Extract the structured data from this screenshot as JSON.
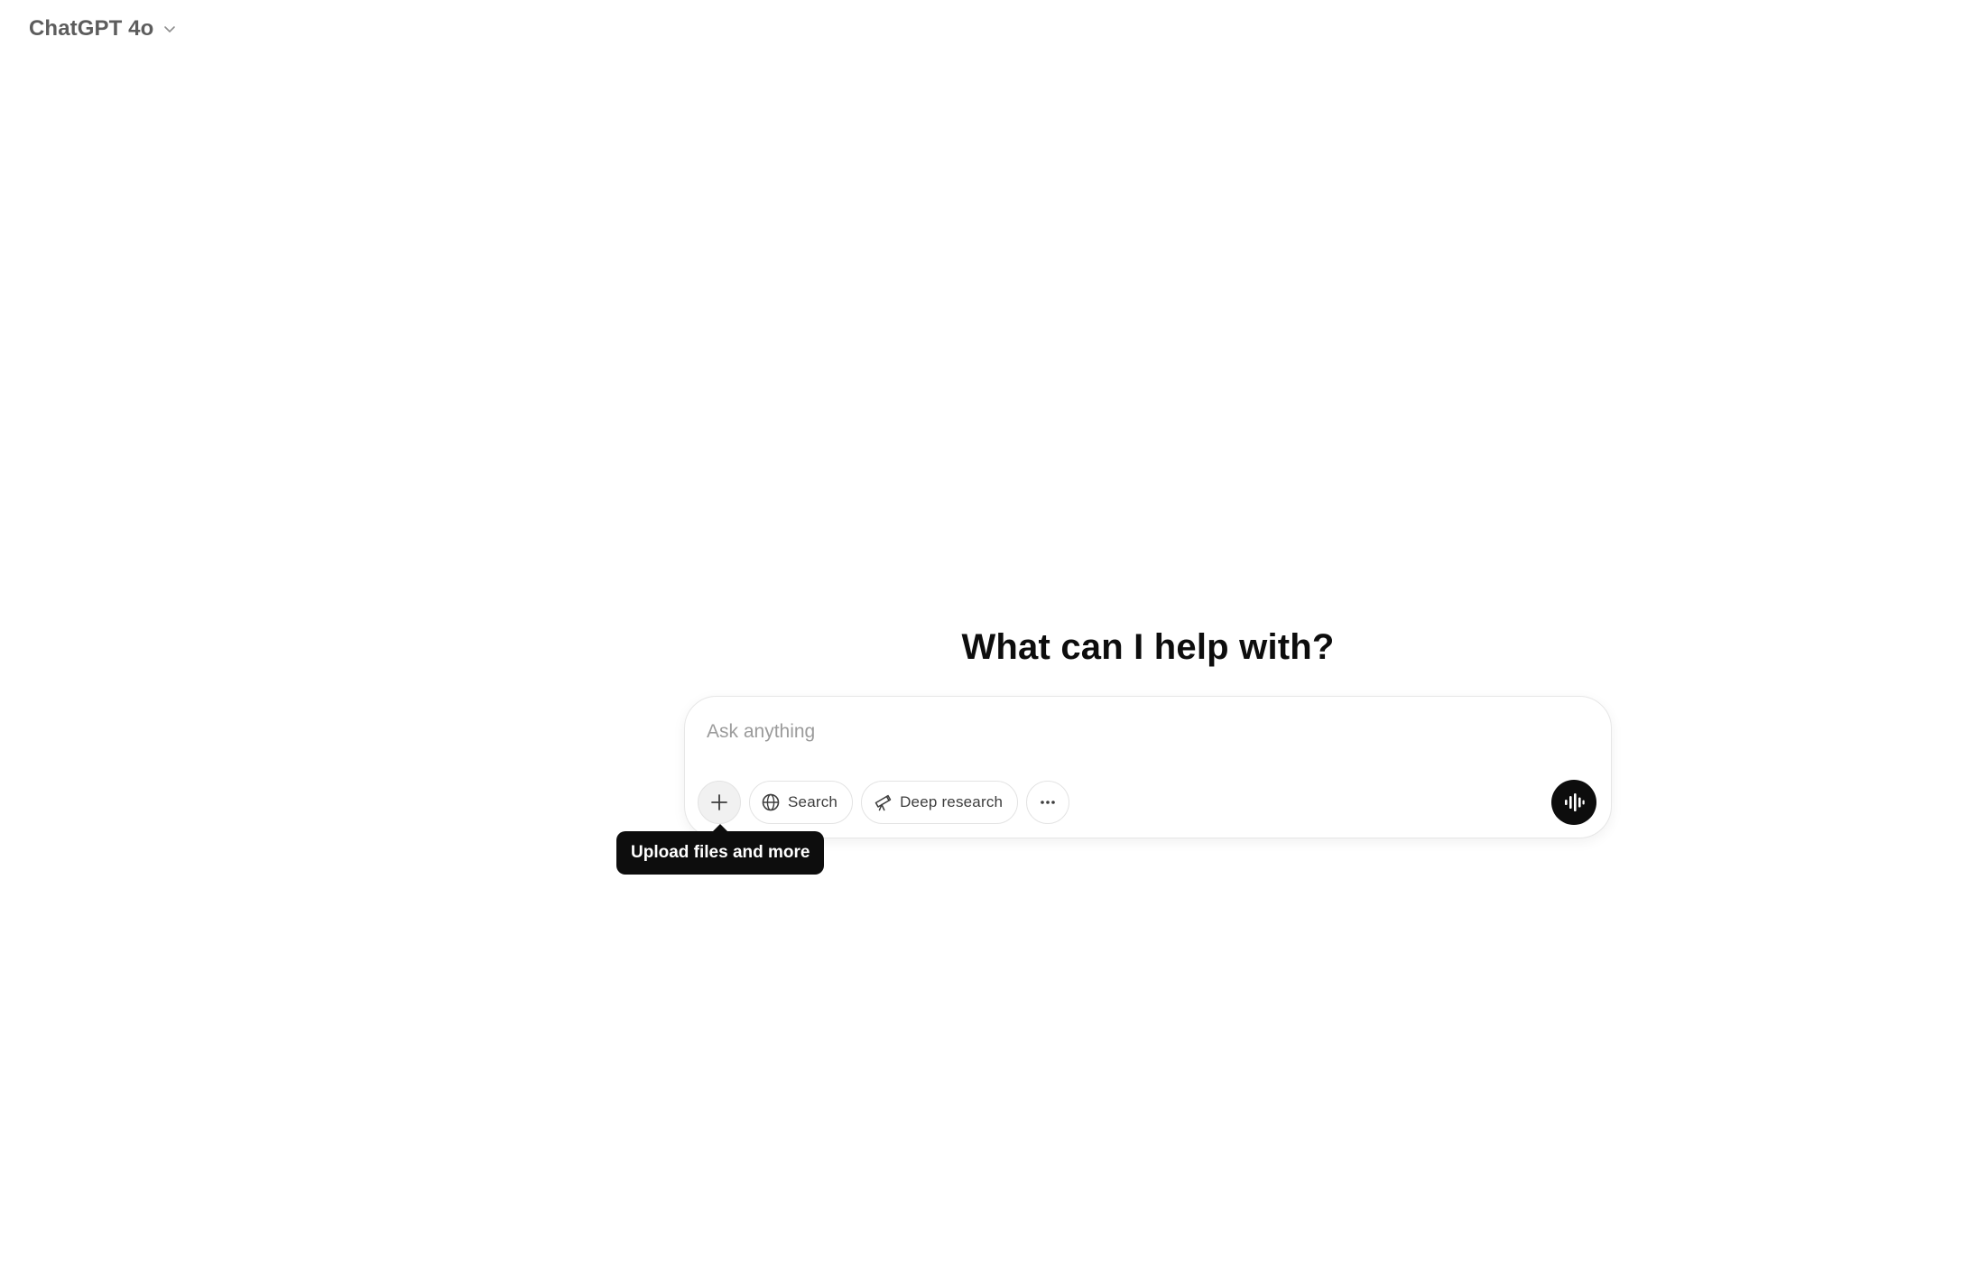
{
  "header": {
    "model_name": "ChatGPT 4o",
    "model_icon": "chevron-down-icon"
  },
  "main": {
    "headline": "What can I help with?"
  },
  "composer": {
    "placeholder": "Ask anything",
    "value": "",
    "tools": {
      "upload_icon": "plus-icon",
      "search_label": "Search",
      "search_icon": "globe-icon",
      "deep_research_label": "Deep research",
      "deep_research_icon": "telescope-icon",
      "more_icon": "more-horizontal-icon"
    },
    "voice_icon": "voice-waveform-icon"
  },
  "tooltip": {
    "text": "Upload files and more"
  },
  "colors": {
    "primary_text": "#0d0d0d",
    "muted_text": "#5d5d5d",
    "placeholder": "#9b9b9b",
    "border": "#e3e3e3",
    "voice_button": "#0d0d0d",
    "tooltip_bg": "#0d0d0d"
  }
}
